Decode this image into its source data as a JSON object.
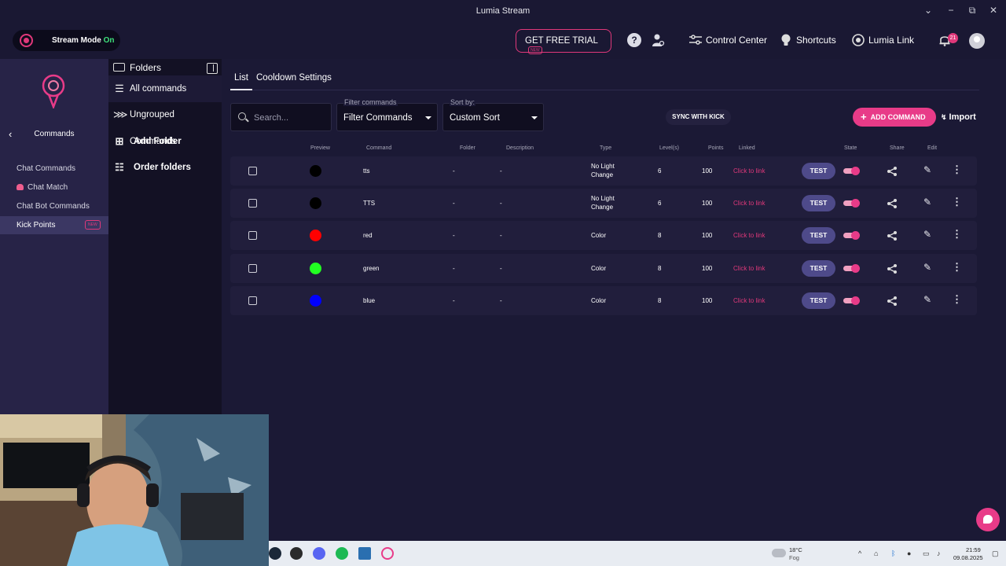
{
  "window": {
    "title": "Lumia Stream",
    "controls": [
      "chevron-down",
      "minimize",
      "restore",
      "close"
    ]
  },
  "topnav": {
    "stream_mode_label": "Stream Mode",
    "stream_mode_state": "On",
    "trial_label": "GET FREE TRIAL",
    "trial_badge": "NEW",
    "control_center": "Control Center",
    "shortcuts": "Shortcuts",
    "lumia_link": "Lumia Link",
    "notifications_count": "21"
  },
  "sidebar": {
    "title": "Commands",
    "items": [
      {
        "label": "Chat Commands"
      },
      {
        "label": "Chat Match"
      },
      {
        "label": "Chat Bot Commands"
      },
      {
        "label": "Kick Points",
        "badge": "NEW",
        "active": true
      }
    ]
  },
  "folders": {
    "header": "Folders",
    "items": [
      {
        "label": "All commands"
      },
      {
        "label": "Ungrouped Commands"
      },
      {
        "label": "Add Folder"
      },
      {
        "label": "Order folders"
      }
    ]
  },
  "main": {
    "tabs": [
      "List",
      "Cooldown Settings"
    ],
    "search_placeholder": "Search...",
    "filter_label": "Filter commands",
    "filter_value": "Filter Commands",
    "sort_label": "Sort by:",
    "sort_value": "Custom Sort",
    "sync_button": "SYNC WITH KICK",
    "add_button": "ADD COMMAND",
    "import_button": "Import",
    "columns": [
      "Preview",
      "Command",
      "Folder",
      "Description",
      "Type",
      "Level(s)",
      "Points",
      "Linked",
      "State",
      "Share",
      "Edit"
    ],
    "test_label": "TEST",
    "rows": [
      {
        "preview_color": "#000000",
        "command": "tts",
        "folder": "-",
        "description": "-",
        "type_line1": "No Light",
        "type_line2": "Change",
        "level": "6",
        "points": "100",
        "linked": "Click to link",
        "state_on": true
      },
      {
        "preview_color": "#000000",
        "command": "TTS",
        "folder": "-",
        "description": "-",
        "type_line1": "No Light",
        "type_line2": "Change",
        "level": "6",
        "points": "100",
        "linked": "Click to link",
        "state_on": true
      },
      {
        "preview_color": "#ff0000",
        "command": "red",
        "folder": "-",
        "description": "-",
        "type_line1": "Color",
        "type_line2": "",
        "level": "8",
        "points": "100",
        "linked": "Click to link",
        "state_on": true
      },
      {
        "preview_color": "#22ff22",
        "command": "green",
        "folder": "-",
        "description": "-",
        "type_line1": "Color",
        "type_line2": "",
        "level": "8",
        "points": "100",
        "linked": "Click to link",
        "state_on": true
      },
      {
        "preview_color": "#0000ff",
        "command": "blue",
        "folder": "-",
        "description": "-",
        "type_line1": "Color",
        "type_line2": "",
        "level": "8",
        "points": "100",
        "linked": "Click to link",
        "state_on": true
      }
    ]
  },
  "taskbar": {
    "weather_temp": "18°C",
    "weather_desc": "Fog",
    "time": "21:59",
    "date": "09.08.2025"
  },
  "colors": {
    "accent": "#e83b88",
    "background": "#1b1935",
    "sidebar": "#272347",
    "folders_panel": "#131124",
    "row": "#211e3c"
  }
}
